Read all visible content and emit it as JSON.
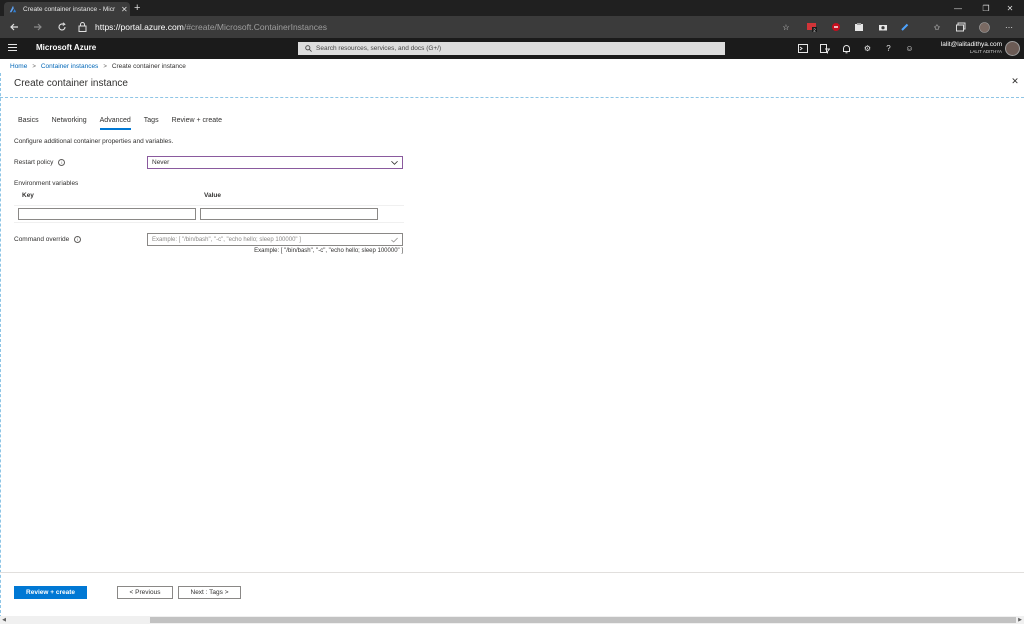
{
  "browser": {
    "tab_title": "Create container instance - Micr",
    "new_tab_glyph": "+",
    "close_tab_glyph": "✕",
    "url_host": "https://portal.azure.com",
    "url_path": "/#create/Microsoft.ContainerInstances",
    "window_controls": [
      "—",
      "❐",
      "✕"
    ],
    "nav_icons": [
      "back-arrow-icon",
      "forward-arrow-icon",
      "refresh-icon"
    ],
    "extension_badge": "2"
  },
  "azure": {
    "brand": "Microsoft Azure",
    "search_placeholder": "Search resources, services, and docs (G+/)",
    "account_email": "lalit@lalitadithya.com",
    "account_directory": "LALIT ADITHYA",
    "toolbar_icons": [
      "cloud-shell-icon",
      "directory-filter-icon",
      "notifications-icon",
      "settings-icon",
      "help-icon",
      "feedback-icon"
    ],
    "help_glyph": "?"
  },
  "breadcrumb": {
    "items": [
      "Home",
      "Container instances"
    ],
    "current": "Create container instance",
    "separator": ">"
  },
  "blade": {
    "title": "Create container instance",
    "close_glyph": "✕"
  },
  "tabs": [
    "Basics",
    "Networking",
    "Advanced",
    "Tags",
    "Review + create"
  ],
  "active_tab": "Advanced",
  "form": {
    "description": "Configure additional container properties and variables.",
    "restart_policy_label": "Restart policy",
    "restart_policy_value": "Never",
    "env_vars_label": "Environment variables",
    "key_header": "Key",
    "value_header": "Value",
    "key_value": "",
    "value_value": "",
    "command_override_label": "Command override",
    "command_override_placeholder": "Example: [ \"/bin/bash\", \"-c\", \"echo hello; sleep 100000\" ]",
    "command_hint": "Example: [ \"/bin/bash\", \"-c\", \"echo hello; sleep 100000\" ]",
    "info_glyph": "i"
  },
  "footer": {
    "review_create": "Review + create",
    "previous": "< Previous",
    "next": "Next : Tags >"
  },
  "colors": {
    "accent": "#0078d4",
    "azure_bar": "#1b1b1b",
    "link": "#0067b8"
  }
}
